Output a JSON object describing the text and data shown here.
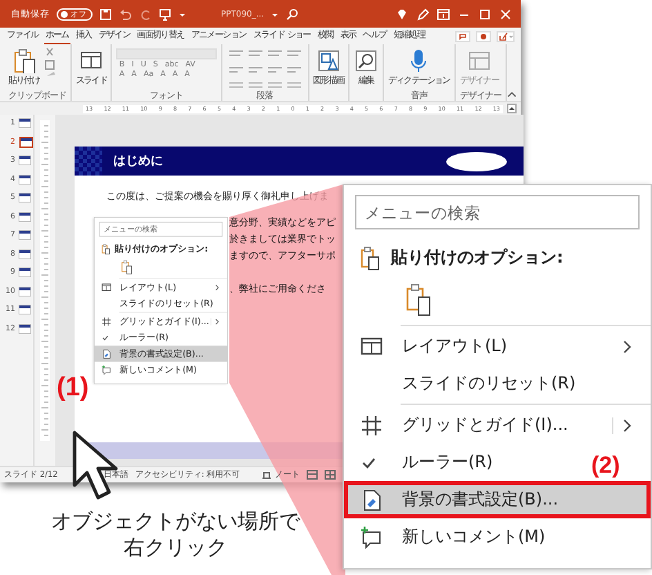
{
  "window": {
    "autosave_label": "自動保存",
    "autosave_toggle": {
      "label": "オフ",
      "on": false
    },
    "title": "PPT090_..."
  },
  "tabs": [
    {
      "label": "ファイル",
      "selected": false
    },
    {
      "label": "ホーム",
      "selected": true
    },
    {
      "label": "挿入",
      "selected": false
    },
    {
      "label": "デザイン",
      "selected": false
    },
    {
      "label": "画面切り替え",
      "selected": false
    },
    {
      "label": "アニメーション",
      "selected": false
    },
    {
      "label": "スライド ショー",
      "selected": false
    },
    {
      "label": "校閲",
      "selected": false
    },
    {
      "label": "表示",
      "selected": false
    },
    {
      "label": "ヘルプ",
      "selected": false
    },
    {
      "label": "短縮処理",
      "selected": false
    }
  ],
  "ribbon": {
    "groups": [
      {
        "kind": "clipboard",
        "label": "クリップボード",
        "button": "貼り付け"
      },
      {
        "kind": "slides",
        "button": "スライド"
      },
      {
        "kind": "font",
        "label": "フォント",
        "controls": [
          "B",
          "I",
          "U",
          "S",
          "abc",
          "AV"
        ],
        "controls_2": [
          "A",
          "A",
          "Aa",
          "A",
          "A",
          "A"
        ]
      },
      {
        "kind": "paragraph",
        "label": "段落"
      },
      {
        "kind": "drawing",
        "button": "図形描画"
      },
      {
        "kind": "editing",
        "button": "編集"
      },
      {
        "kind": "voice",
        "label": "音声",
        "button": "ディクテーション"
      },
      {
        "kind": "designer",
        "label": "デザイナー",
        "button": "デザイナー"
      }
    ]
  },
  "ruler": [
    "13",
    "12",
    "11",
    "10",
    "9",
    "8",
    "7",
    "6",
    "5",
    "4",
    "3",
    "2",
    "1",
    "0",
    "1",
    "2",
    "3",
    "4",
    "5",
    "6",
    "7",
    "8",
    "9",
    "10",
    "11",
    "12",
    "13"
  ],
  "thumbnails": [
    {
      "number": "1",
      "selected": false
    },
    {
      "number": "2",
      "selected": true
    },
    {
      "number": "3",
      "selected": false
    },
    {
      "number": "4",
      "selected": false
    },
    {
      "number": "5",
      "selected": false
    },
    {
      "number": "6",
      "selected": false
    },
    {
      "number": "7",
      "selected": false
    },
    {
      "number": "8",
      "selected": false
    },
    {
      "number": "9",
      "selected": false
    },
    {
      "number": "10",
      "selected": false
    },
    {
      "number": "11",
      "selected": false
    },
    {
      "number": "12",
      "selected": false
    }
  ],
  "slide": {
    "title": "はじめに",
    "lead": "この度は、ご提案の機会を賜り厚く御礼申し上げま",
    "lines": [
      "意分野、実績などをアピ",
      "於きましては業界でトッ",
      "ますので、アフターサポ",
      "、弊社にご用命くださ"
    ]
  },
  "status_bar": {
    "slide": "スライド 2/12",
    "language": "日本語",
    "accessibility": "アクセシビリティ: 利用不可",
    "notes": "ノート"
  },
  "mini_menu": {
    "items": [
      {
        "kind": "search",
        "placeholder": "メニューの検索"
      },
      {
        "kind": "heading",
        "label": "貼り付けのオプション:"
      },
      {
        "kind": "paste-option"
      },
      {
        "kind": "separator"
      },
      {
        "kind": "layout",
        "label": "レイアウト(L)",
        "submenu": true,
        "checked": false,
        "highlighted": false,
        "framed": false
      },
      {
        "kind": "reset",
        "label": "スライドのリセット(R)",
        "submenu": false,
        "checked": false,
        "highlighted": false,
        "framed": false
      },
      {
        "kind": "separator"
      },
      {
        "kind": "grid",
        "label": "グリッドとガイド(I)...",
        "submenu": true,
        "checked": false,
        "highlighted": false,
        "framed": false
      },
      {
        "kind": "ruler",
        "label": "ルーラー(R)",
        "submenu": false,
        "checked": true,
        "highlighted": false,
        "framed": false
      },
      {
        "kind": "background",
        "label": "背景の書式設定(B)...",
        "submenu": false,
        "checked": false,
        "highlighted": true,
        "framed": false
      },
      {
        "kind": "comment",
        "label": "新しいコメント(M)",
        "submenu": false,
        "checked": false,
        "highlighted": false,
        "framed": false
      }
    ]
  },
  "menu": {
    "items": [
      {
        "kind": "search",
        "placeholder": "メニューの検索"
      },
      {
        "kind": "heading",
        "label": "貼り付けのオプション:"
      },
      {
        "kind": "paste-option"
      },
      {
        "kind": "separator"
      },
      {
        "kind": "layout",
        "label": "レイアウト(L)",
        "submenu": true,
        "checked": false,
        "highlighted": false,
        "framed": false
      },
      {
        "kind": "reset",
        "label": "スライドのリセット(R)",
        "submenu": false,
        "checked": false,
        "highlighted": false,
        "framed": false
      },
      {
        "kind": "separator"
      },
      {
        "kind": "grid",
        "label": "グリッドとガイド(I)...",
        "submenu": true,
        "checked": false,
        "highlighted": false,
        "framed": false
      },
      {
        "kind": "ruler",
        "label": "ルーラー(R)",
        "submenu": false,
        "checked": true,
        "highlighted": false,
        "framed": false
      },
      {
        "kind": "background",
        "label": "背景の書式設定(B)...",
        "submenu": false,
        "checked": false,
        "highlighted": true,
        "framed": true
      },
      {
        "kind": "comment",
        "label": "新しいコメント(M)",
        "submenu": false,
        "checked": false,
        "highlighted": false,
        "framed": false
      }
    ]
  },
  "annotations": {
    "step_1": "(1)",
    "step_2": "(2)",
    "caption": "オブジェクトがない場所で右クリック"
  }
}
